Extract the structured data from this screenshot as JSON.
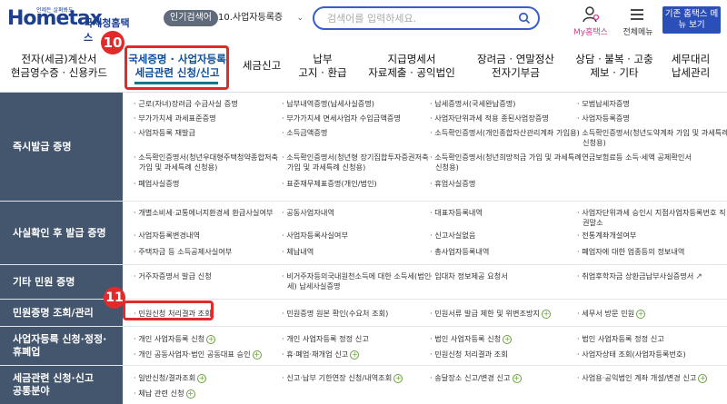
{
  "header": {
    "logo_mark": "Hometax",
    "logo_slogan": "언제든 살펴봐도",
    "logo_name": "국세청홈택스",
    "popular_label": "인기검색어",
    "popular_value": "10.사업자등록증",
    "search_placeholder": "검색어를 입력하세요.",
    "my_hometax": "My홈택스",
    "all_menu": "전체메뉴",
    "basic_hometax": "기존 홈택스 메뉴 보기"
  },
  "nav": {
    "items": [
      {
        "line1": "전자(세금)계산서",
        "line2": "현금영수증 · 신용카드"
      },
      {
        "line1": "국세증명 · 사업자등록",
        "line2": "세금관련 신청/신고"
      },
      {
        "line1": "세금신고",
        "line2": ""
      },
      {
        "line1": "납부",
        "line2": "고지 · 환급"
      },
      {
        "line1": "지급명세서",
        "line2": "자료제출 · 공익법인"
      },
      {
        "line1": "장려금 · 연말정산",
        "line2": "전자기부금"
      },
      {
        "line1": "상담 · 불복 · 고충",
        "line2": "제보 · 기타"
      },
      {
        "line1": "세무대리",
        "line2": "납세관리"
      }
    ]
  },
  "annotations": {
    "step10": "10",
    "step11": "11"
  },
  "rows": [
    {
      "category": "즉시발급 증명",
      "items": [
        "· 근로(자녀)장려금 수급사실 증명",
        "· 납부내역증명(납세사실증명)",
        "· 납세증명서(국세완납증명)",
        "· 모범납세자증명",
        "· 부가가치세 과세표준증명",
        "· 부가가치세 면세사업자 수입금액증명",
        "· 사업자단위과세 적용 종된사업장증명",
        "· 사업자등록증명",
        "· 사업자등록 재발급",
        "· 소득금액증명",
        "· 소득확인증명서(개인종합자산관리계좌 가입용)",
        "· 소득확인증명서(청년도약계좌 가입 및 과세특례",
        "신청용)",
        "· 소득확인증명서(청년우대형주택청약종합저축",
        "가입 및 과세특례 신청용)",
        "· 소득확인증명서(청년형 장기집합투자증권저축",
        "가입 및 과세특례 신청용)",
        "· 소득확인증명서(청년희망적금 가입 및 과세특례",
        "신청용)",
        "· 연금보험료등 소득·세액 공제확인서",
        "· 폐업사실증명",
        "· 표준재무제표증명(개인/법인)",
        "· 휴업사실증명"
      ]
    },
    {
      "category": "사실확인 후 발급 증명",
      "items": [
        "· 개별소비세·교통에너지환경세 환급사실여부",
        "· 공동사업자내역",
        "· 대표자등록내역",
        "· 사업자단위과세 승인시 지점사업자등록번호 직",
        "권말소",
        "· 사업자등록변경내역",
        "· 사업자등록사실여부",
        "· 신고사실없음",
        "· 전통계좌개설여부",
        "· 주택자금 등 소득공제사실여부",
        "· 체납내역",
        "· 총사업자등록내역",
        "· 폐업자에 대한 업종등의 정보내역"
      ]
    },
    {
      "category": "기타 민원 증명",
      "items": [
        "· 거주자증명서 발급 신청",
        "· 비거주자등의국내원천소득에 대한 소득세(법인",
        "세) 납세사실증명",
        "· 임대차 정보제공 요청서",
        "· 취업후학자금 상환금납부사실증명서"
      ]
    },
    {
      "category": "민원증명 조회/관리",
      "items": [
        "· 민원신청 처리결과 조회",
        "· 민원증명 원본 확인(수요처 조회)",
        "· 민원서류 발급 제한 및 위변조방지",
        "· 세무서 방문 민원"
      ]
    },
    {
      "category": "사업자등록 신청·정정·휴폐업",
      "cat_line1": "사업자등록 신청·정정·",
      "cat_line2": "휴폐업",
      "items": [
        "· 개인 사업자등록 신청",
        "· 개인 사업자등록 정정 신고",
        "· 법인 사업자등록 신청",
        "· 법인 사업자등록 정정 신고",
        "· 개인 공동사업자·법인 공동대표 승인",
        "· 휴·폐업·재개업 신고",
        "· 민원신청 처리결과 조회",
        "· 사업자상태 조회(사업자등록번호)"
      ]
    },
    {
      "category": "세금관련 신청·신고 공통분야",
      "cat_line1": "세금관련 신청·신고",
      "cat_line2": "공통분야",
      "items": [
        "· 일반신청/결과조회",
        "· 신고·납부 기한연장 신청/내역조회",
        "· 송달장소 신고/변경 신고",
        "· 사업용·공익법인 계좌 개설/변경 신고",
        "· 체납 관련 신청"
      ]
    }
  ],
  "colors": {
    "accent": "#2b4fb8",
    "category_bg": "#43566e",
    "highlight": "#e12a2a",
    "plus": "#6aa03a"
  }
}
